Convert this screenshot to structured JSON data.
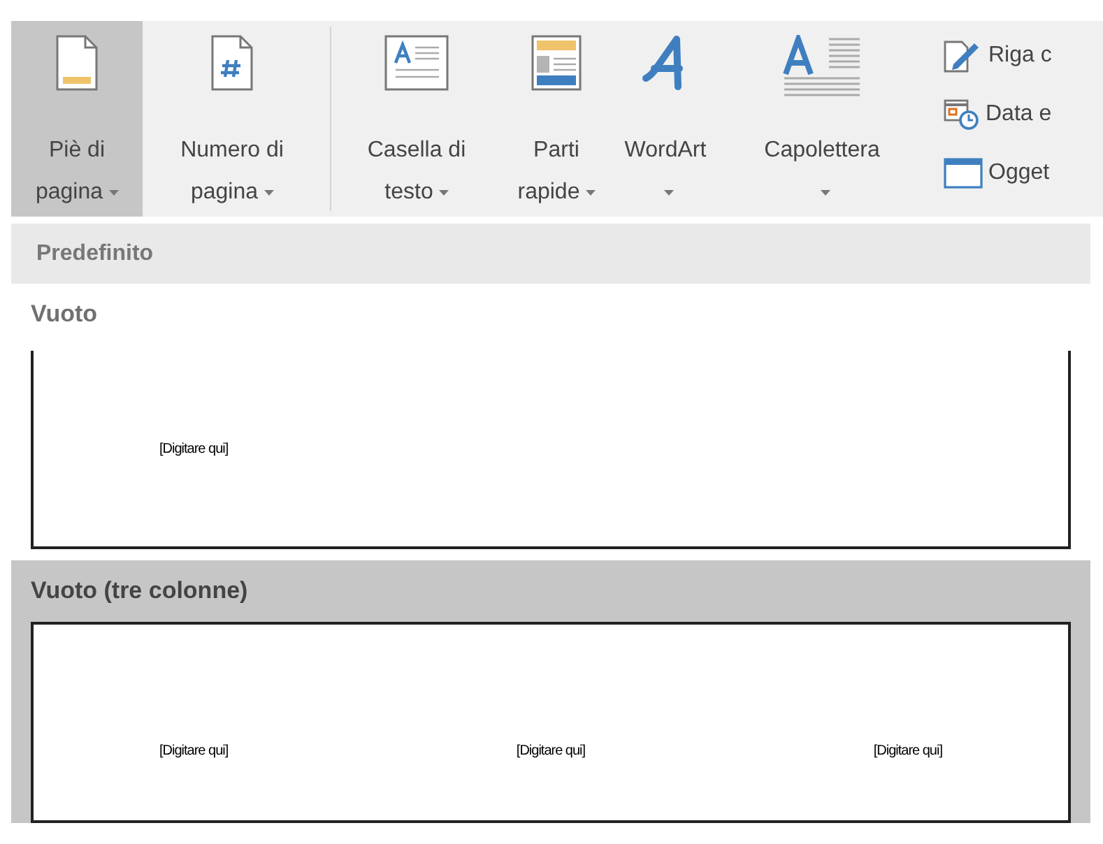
{
  "ribbon": {
    "buttons": [
      {
        "kind": "footer",
        "line1": "Piè di",
        "line2": "pagina",
        "selected": true
      },
      {
        "kind": "page-number",
        "line1": "Numero di",
        "line2": "pagina",
        "selected": false
      },
      {
        "kind": "text-box",
        "line1": "Casella di",
        "line2": "testo",
        "selected": false
      },
      {
        "kind": "quick-parts",
        "line1": "Parti",
        "line2": "rapide",
        "selected": false
      },
      {
        "kind": "wordart",
        "line1": "WordArt",
        "selected": false
      },
      {
        "kind": "drop-cap",
        "line1": "Capolettera",
        "selected": false
      }
    ],
    "small_buttons": [
      {
        "kind": "signature",
        "label": "Riga c"
      },
      {
        "kind": "date-time",
        "label": "Data e"
      },
      {
        "kind": "object",
        "label": "Ogget"
      }
    ]
  },
  "gallery": {
    "section": "Predefinito",
    "items": [
      {
        "title": "Vuoto",
        "selected": false,
        "placeholders": [
          "[Digitare qui]"
        ]
      },
      {
        "title": "Vuoto (tre colonne)",
        "selected": true,
        "placeholders": [
          "[Digitare qui]",
          "[Digitare qui]",
          "[Digitare qui]"
        ]
      }
    ]
  }
}
